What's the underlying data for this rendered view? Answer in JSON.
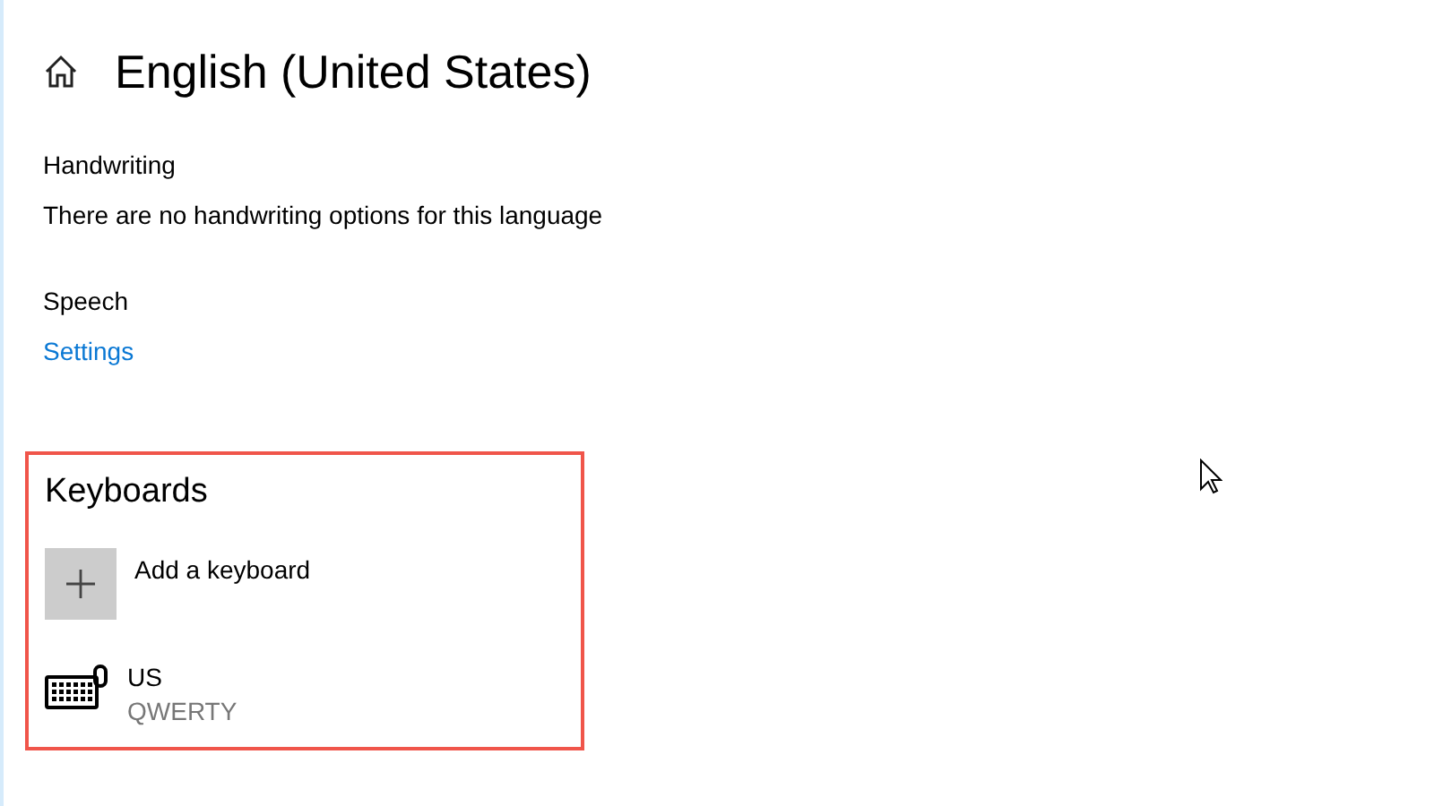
{
  "header": {
    "title": "English (United States)"
  },
  "handwriting": {
    "heading": "Handwriting",
    "message": "There are no handwriting options for this language"
  },
  "speech": {
    "heading": "Speech",
    "link": "Settings"
  },
  "keyboards": {
    "heading": "Keyboards",
    "highlighted": true,
    "items": [
      {
        "kind": "add",
        "label": "Add a keyboard"
      },
      {
        "kind": "keyboard",
        "label": "US",
        "sublabel": "QWERTY"
      }
    ]
  }
}
